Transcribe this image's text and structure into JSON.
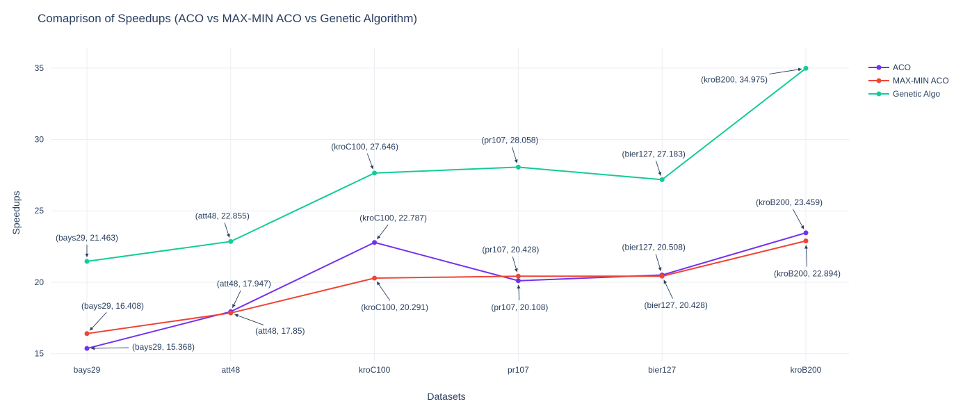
{
  "chart_data": {
    "type": "line",
    "title": "Comaprison of Speedups (ACO vs MAX-MIN ACO vs Genetic Algorithm)",
    "xlabel": "Datasets",
    "ylabel": "Speedups",
    "categories": [
      "bays29",
      "att48",
      "kroC100",
      "pr107",
      "bier127",
      "kroB200"
    ],
    "ylim": [
      14.5,
      36.4
    ],
    "yticks": [
      15,
      20,
      25,
      30,
      35
    ],
    "grid": true,
    "legend_position": "top-right",
    "series": [
      {
        "name": "ACO",
        "color": "#7333ee",
        "values": [
          15.368,
          17.947,
          22.787,
          20.108,
          20.508,
          23.459
        ]
      },
      {
        "name": "MAX-MIN ACO",
        "color": "#ef4535",
        "values": [
          16.408,
          17.85,
          20.291,
          20.428,
          20.428,
          22.894
        ]
      },
      {
        "name": "Genetic Algo",
        "color": "#13cc97",
        "values": [
          21.463,
          22.855,
          27.646,
          28.058,
          27.183,
          34.975
        ]
      }
    ],
    "annotations": [
      {
        "text": "(bays29, 21.463)",
        "x": "bays29",
        "y": 21.463,
        "dx": 0,
        "dy": -34
      },
      {
        "text": "(att48, 22.855)",
        "x": "att48",
        "y": 22.855,
        "dx": -12,
        "dy": -37
      },
      {
        "text": "(kroC100, 27.646)",
        "x": "kroC100",
        "y": 27.646,
        "dx": -14,
        "dy": -38
      },
      {
        "text": "(pr107, 28.058)",
        "x": "pr107",
        "y": 28.058,
        "dx": -12,
        "dy": -39
      },
      {
        "text": "(bier127, 27.183)",
        "x": "bier127",
        "y": 27.183,
        "dx": -12,
        "dy": -37
      },
      {
        "text": "(kroB200, 34.975)",
        "x": "kroB200",
        "y": 34.975,
        "dx": -103,
        "dy": 16
      },
      {
        "text": "(bays29, 16.408)",
        "x": "bays29",
        "y": 16.408,
        "dx": 37,
        "dy": -40
      },
      {
        "text": "(att48, 17.947)",
        "x": "att48",
        "y": 17.947,
        "dx": 19,
        "dy": -40
      },
      {
        "text": "(kroC100, 22.787)",
        "x": "kroC100",
        "y": 22.787,
        "dx": 27,
        "dy": -35
      },
      {
        "text": "(pr107, 20.428)",
        "x": "pr107",
        "y": 20.428,
        "dx": -11,
        "dy": -38
      },
      {
        "text": "(bier127, 20.508)",
        "x": "bier127",
        "y": 20.508,
        "dx": -12,
        "dy": -40
      },
      {
        "text": "(kroB200, 23.459)",
        "x": "kroB200",
        "y": 23.459,
        "dx": -24,
        "dy": -44
      },
      {
        "text": "(bays29, 15.368)",
        "x": "bays29",
        "y": 15.368,
        "dx": 110,
        "dy": -2
      },
      {
        "text": "(att48, 17.85)",
        "x": "att48",
        "y": 17.85,
        "dx": 71,
        "dy": 26
      },
      {
        "text": "(kroC100, 20.291)",
        "x": "kroC100",
        "y": 20.291,
        "dx": 29,
        "dy": 42
      },
      {
        "text": "(pr107, 20.108)",
        "x": "pr107",
        "y": 20.108,
        "dx": 2,
        "dy": 38
      },
      {
        "text": "(bier127, 20.428)",
        "x": "bier127",
        "y": 20.428,
        "dx": 20,
        "dy": 42
      },
      {
        "text": "(kroB200, 22.894)",
        "x": "kroB200",
        "y": 22.894,
        "dx": 2,
        "dy": 47
      }
    ]
  }
}
